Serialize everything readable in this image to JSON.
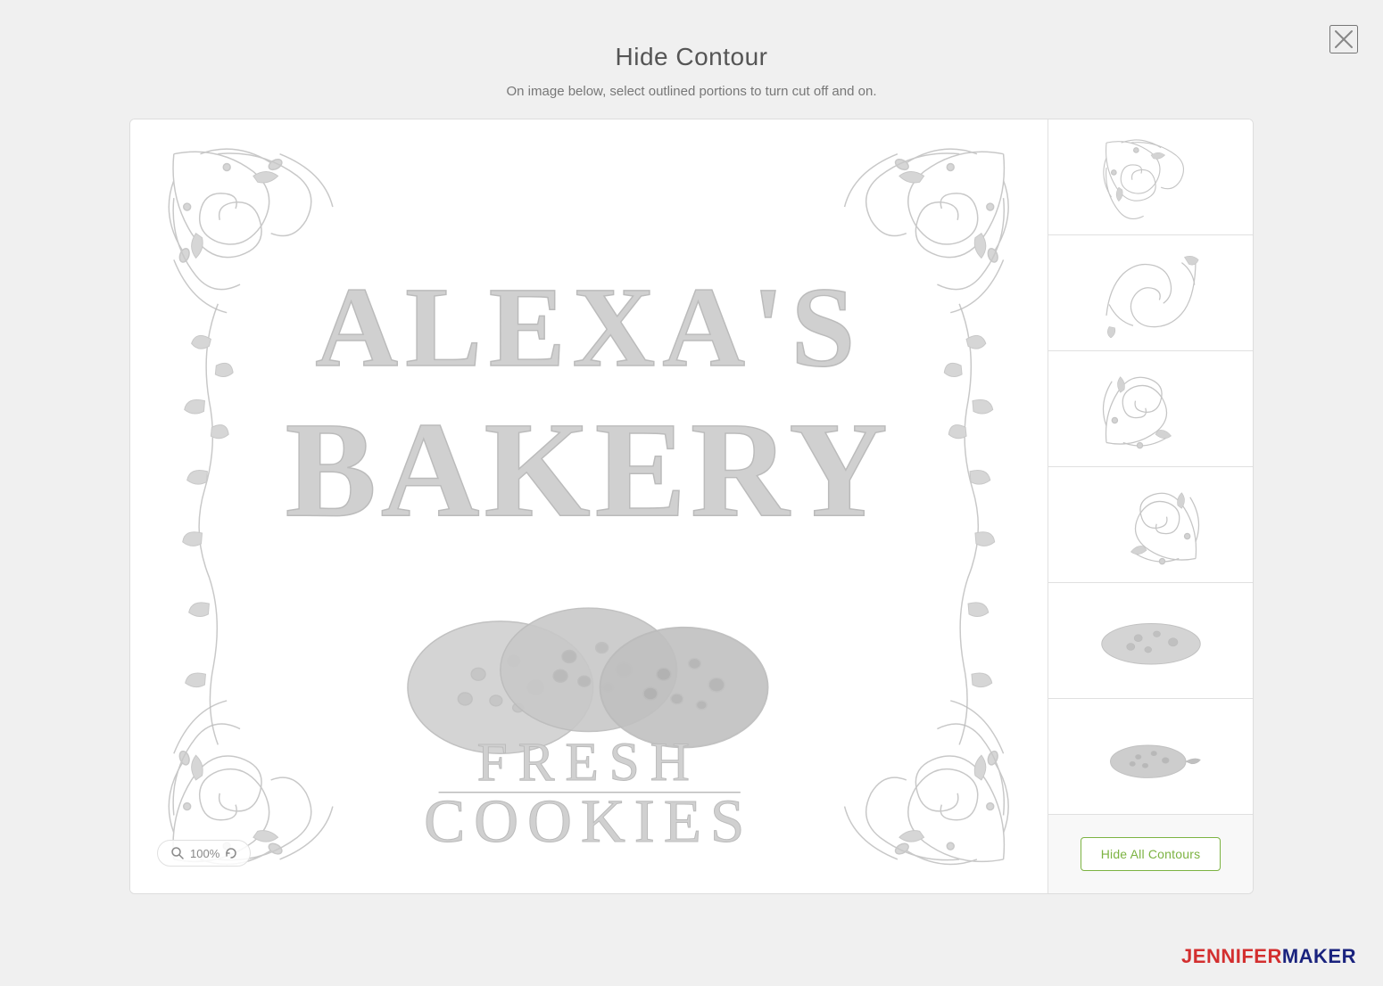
{
  "modal": {
    "title": "Hide Contour",
    "subtitle": "On image below, select outlined portions to turn cut off and on.",
    "close_label": "×"
  },
  "zoom": {
    "level": "100%"
  },
  "sidebar": {
    "items": [
      {
        "id": "corner-tl",
        "label": "Top-left corner flourish"
      },
      {
        "id": "corner-tr",
        "label": "Top-right corner flourish"
      },
      {
        "id": "corner-bl",
        "label": "Bottom-left corner flourish"
      },
      {
        "id": "corner-br",
        "label": "Bottom-right corner flourish"
      },
      {
        "id": "cookie-blob",
        "label": "Cookie blob"
      },
      {
        "id": "cookie-small",
        "label": "Small cookie"
      }
    ],
    "hide_all_label": "Hide All Contours"
  },
  "branding": {
    "jennifer": "JENNIFER",
    "maker": "MAKER"
  }
}
